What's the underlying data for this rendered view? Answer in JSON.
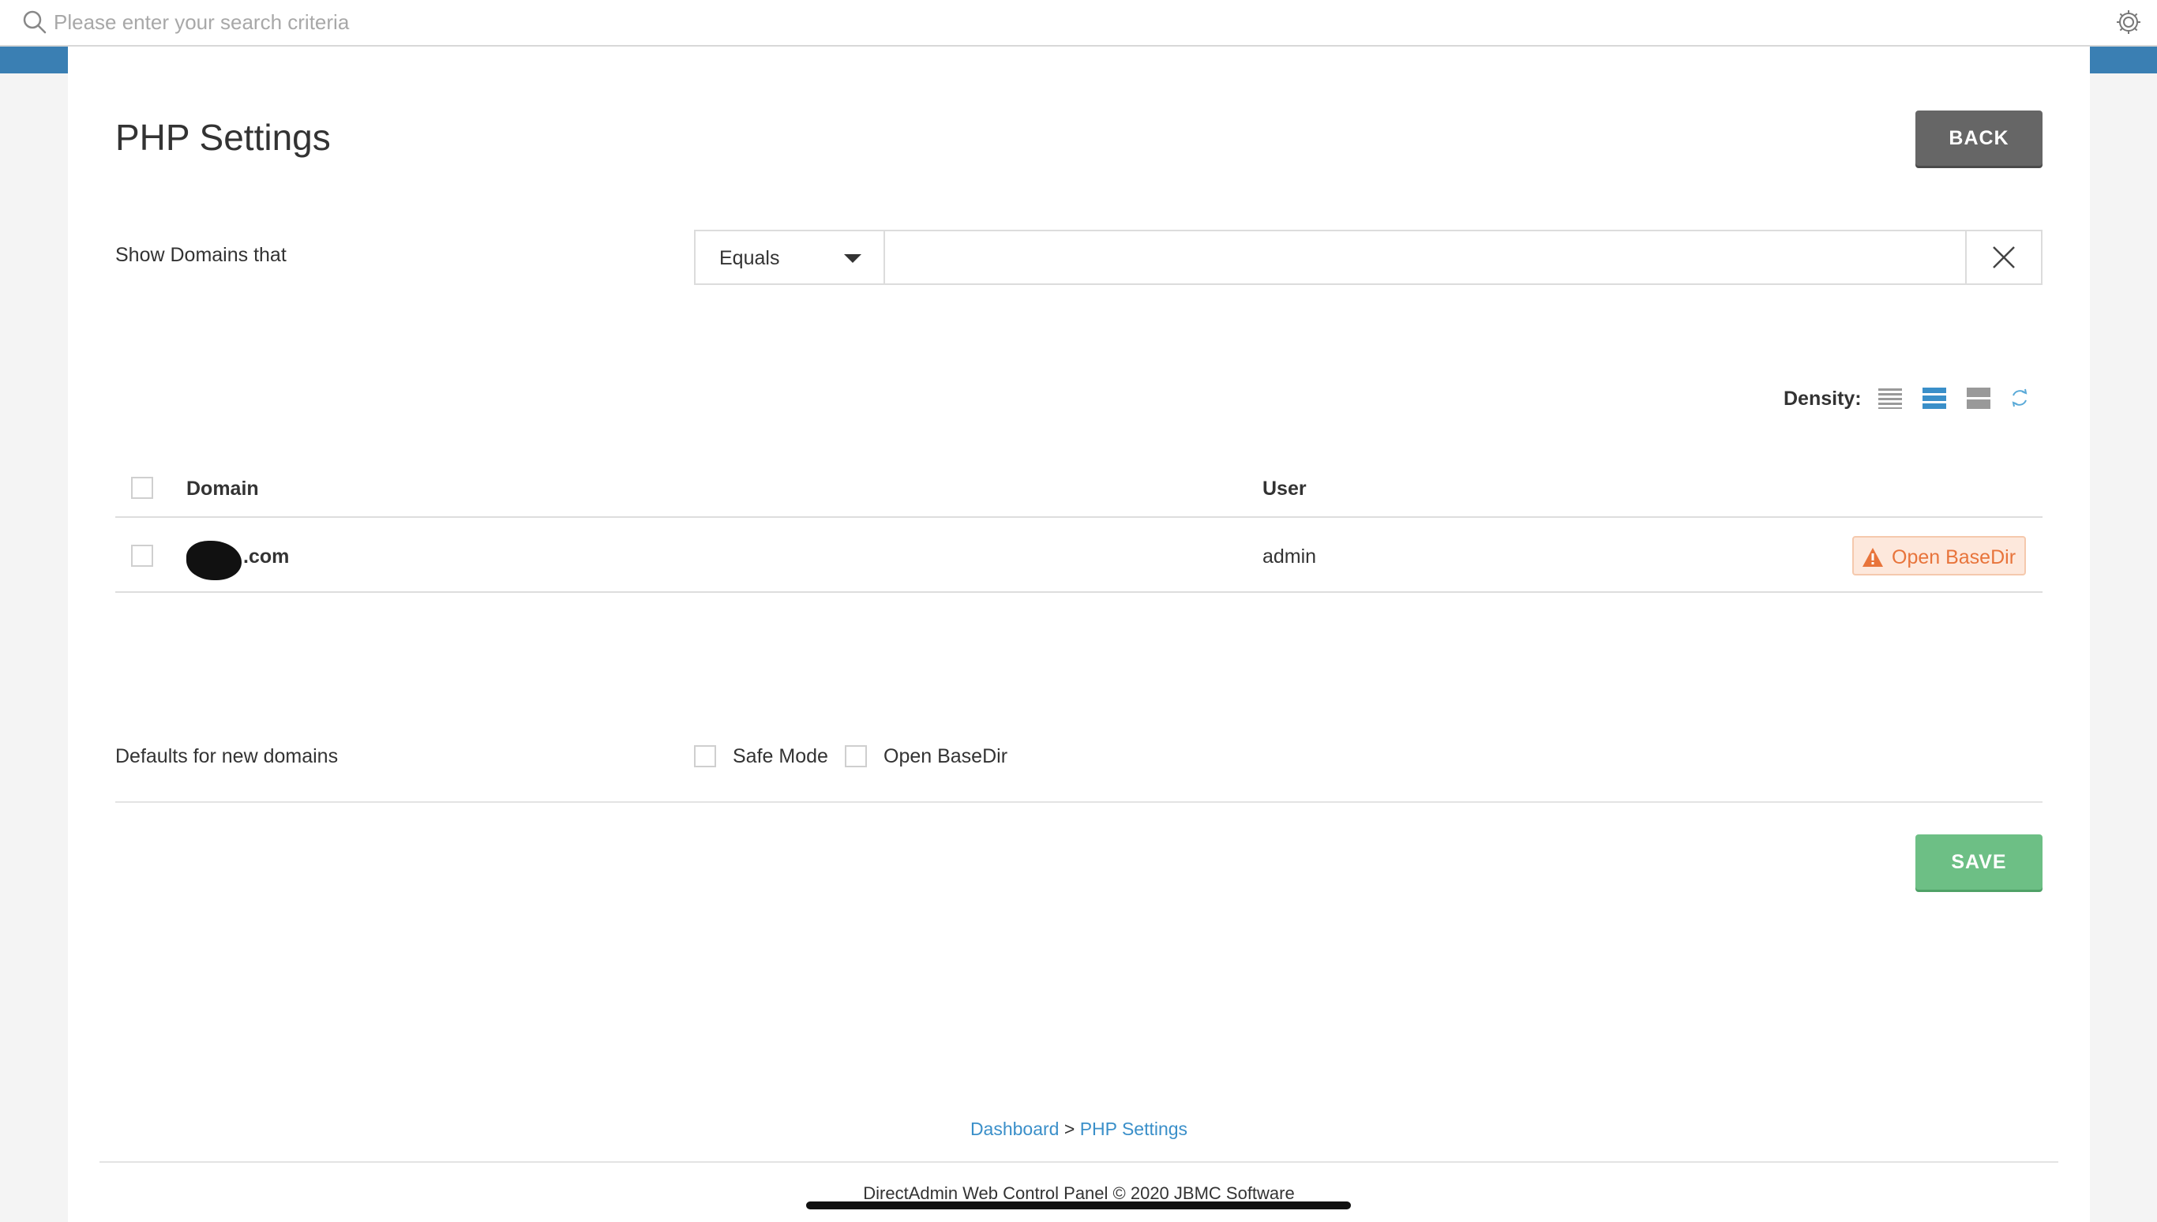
{
  "search": {
    "placeholder": "Please enter your search criteria"
  },
  "header": {
    "title": "PHP Settings",
    "back_label": "BACK"
  },
  "filter": {
    "label": "Show Domains that",
    "operator": "Equals",
    "value": ""
  },
  "density": {
    "label": "Density:",
    "options": [
      "compact",
      "normal",
      "comfortable"
    ],
    "selected": "normal"
  },
  "table": {
    "columns": [
      "Domain",
      "User"
    ],
    "rows": [
      {
        "domain": ".com",
        "user": "admin",
        "action_label": "Open BaseDir"
      }
    ]
  },
  "defaults": {
    "label": "Defaults for new domains",
    "safe_mode_label": "Safe Mode",
    "open_basedir_label": "Open BaseDir"
  },
  "save_label": "SAVE",
  "breadcrumb": {
    "home": "Dashboard",
    "separator": ">",
    "current": "PHP Settings"
  },
  "footer": {
    "text": "DirectAdmin Web Control Panel © 2020 JBMC Software"
  },
  "colors": {
    "accent": "#3a7fb3",
    "link": "#3a8fc9",
    "back_button": "#666666",
    "save_button": "#6dbf85",
    "warning": "#e8743b"
  }
}
